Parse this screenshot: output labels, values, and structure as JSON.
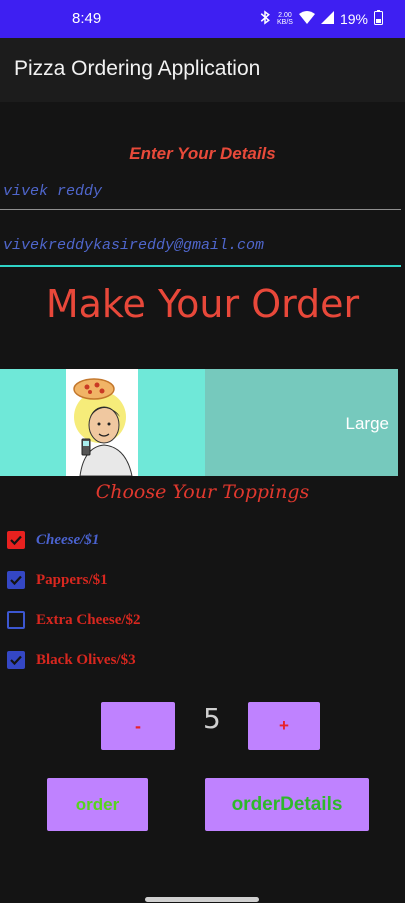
{
  "status_bar": {
    "time": "8:49",
    "net_speed_value": "2.00",
    "net_speed_unit": "KB/S",
    "battery": "19%"
  },
  "app_bar": {
    "title": "Pizza Ordering Application"
  },
  "details": {
    "heading": "Enter Your Details",
    "name_value": "vivek reddy",
    "email_value": "vivekreddykasireddy@gmail.com"
  },
  "order_heading": "Make Your Order",
  "size": {
    "label": "Large"
  },
  "toppings": {
    "heading": "Choose Your Toppings",
    "items": [
      {
        "label": "Cheese/$1",
        "checked": true,
        "color": "#4a62cf"
      },
      {
        "label": "Pappers/$1",
        "checked": true,
        "color": "#d8271f"
      },
      {
        "label": "Extra Cheese/$2",
        "checked": false,
        "color": "#d8271f"
      },
      {
        "label": "Black Olives/$3",
        "checked": true,
        "color": "#d8271f"
      }
    ]
  },
  "quantity": {
    "minus_label": "-",
    "value": "5",
    "plus_label": "+"
  },
  "actions": {
    "order_label": "order",
    "details_label": "orderDetails"
  },
  "colors": {
    "status_bar": "#3e1ff2",
    "accent": "#2fd4c7",
    "button": "#bf82ff",
    "heading_red": "#e8483a"
  }
}
